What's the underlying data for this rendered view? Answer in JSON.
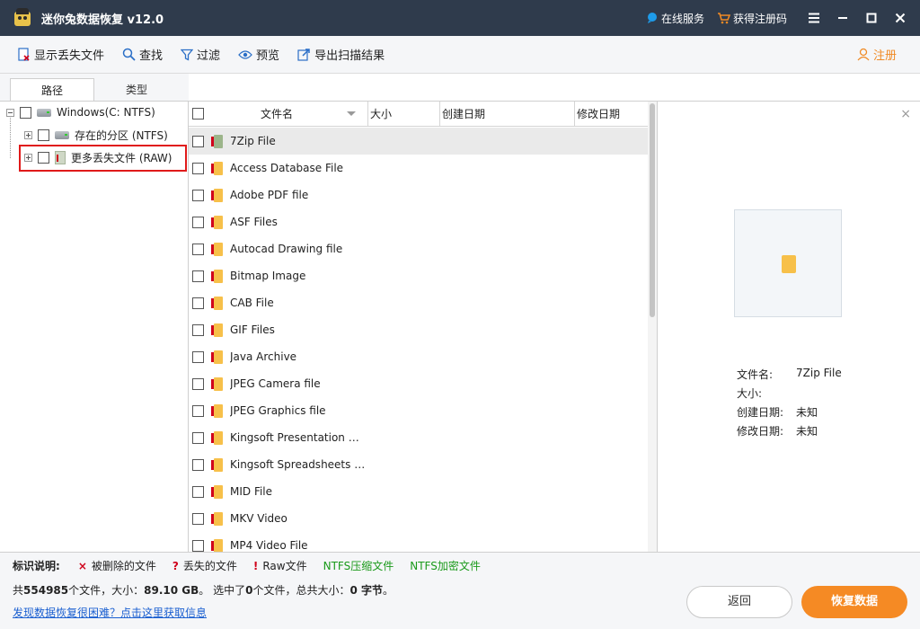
{
  "app": {
    "title": "迷你兔数据恢复 v12.0"
  },
  "titlebar": {
    "online_service": "在线服务",
    "get_code": "获得注册码"
  },
  "toolbar": {
    "show_lost": "显示丢失文件",
    "find": "查找",
    "filter": "过滤",
    "preview": "预览",
    "export": "导出扫描结果",
    "register": "注册"
  },
  "tabs": {
    "path": "路径",
    "type": "类型"
  },
  "tree": {
    "root": "Windows(C: NTFS)",
    "existing": "存在的分区 (NTFS)",
    "more_lost": "更多丢失文件 (RAW)"
  },
  "filelist": {
    "headers": {
      "name": "文件名",
      "size": "大小",
      "created": "创建日期",
      "modified": "修改日期"
    },
    "rows": [
      "7Zip File",
      "Access Database File",
      "Adobe PDF file",
      "ASF Files",
      "Autocad Drawing file",
      "Bitmap Image",
      "CAB File",
      "GIF Files",
      "Java Archive",
      "JPEG Camera file",
      "JPEG Graphics file",
      "Kingsoft Presentation Do…",
      "Kingsoft Spreadsheets File",
      "MID File",
      "MKV Video",
      "MP4 Video File"
    ]
  },
  "preview": {
    "name_label": "文件名:",
    "name_value": "7Zip File",
    "size_label": "大小:",
    "created_label": "创建日期:",
    "created_value": "未知",
    "modified_label": "修改日期:",
    "modified_value": "未知"
  },
  "legend": {
    "label": "标识说明:",
    "deleted_sym": "×",
    "deleted": "被删除的文件",
    "lost_sym": "?",
    "lost": "丢失的文件",
    "raw_sym": "!",
    "raw": "Raw文件",
    "ntfs_compressed": "NTFS压缩文件",
    "ntfs_encrypted": "NTFS加密文件"
  },
  "summary": {
    "p1": "共",
    "count": "554985",
    "p2": "个文件，大小：",
    "size": "89.10 GB",
    "p3": "。 选中了",
    "sel_count": "0",
    "p4": "个文件，总共大小：",
    "sel_size": "0 字节",
    "p5": "。"
  },
  "help_link": "发现数据恢复很困难？点击这里获取信息",
  "buttons": {
    "back": "返回",
    "recover": "恢复数据"
  },
  "colors": {
    "titlebar": "#2f3b4c",
    "accent": "#f58a24",
    "highlight": "#e01a1a"
  }
}
